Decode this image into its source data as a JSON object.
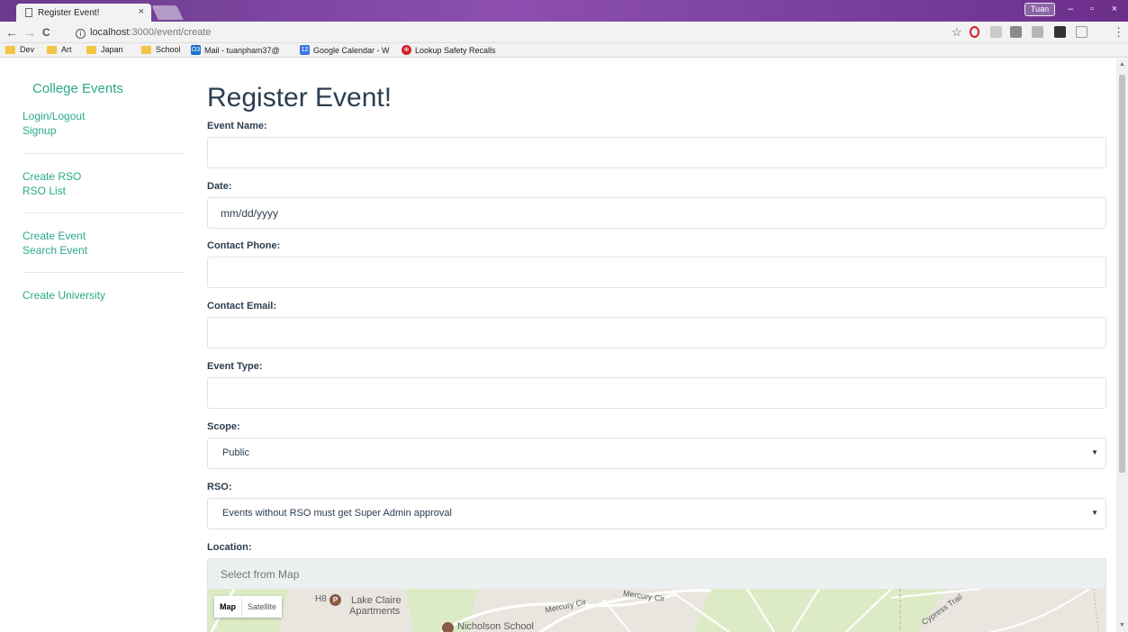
{
  "browser": {
    "tab_title": "Register Event!",
    "tab_close": "×",
    "user_badge": "Tuan",
    "url_host": "localhost",
    "url_path": ":3000/event/create",
    "window_controls": {
      "minimize": "–",
      "maximize": "▫",
      "close": "×"
    },
    "nav": {
      "back": "←",
      "forward": "→",
      "reload": "C"
    },
    "star": "☆",
    "menu": "⋮"
  },
  "bookmarks": [
    {
      "label": "Dev",
      "icon": "folder-icon"
    },
    {
      "label": "Art",
      "icon": "folder-icon"
    },
    {
      "label": "Japan",
      "icon": "folder-icon"
    },
    {
      "label": "School",
      "icon": "folder-icon"
    },
    {
      "label": "Mail - tuanpham37@",
      "icon": "outlook-icon",
      "badge": "O3"
    },
    {
      "label": "Google Calendar - W",
      "icon": "calendar-icon",
      "badge": "12"
    },
    {
      "label": "Lookup Safety Recalls",
      "icon": "toyota-icon",
      "badge": "⊕"
    }
  ],
  "sidebar": {
    "brand": "College Events",
    "groups": [
      [
        "Login/Logout",
        "Signup"
      ],
      [
        "Create RSO",
        "RSO List"
      ],
      [
        "Create Event",
        "Search Event"
      ],
      [
        "Create University"
      ]
    ]
  },
  "form": {
    "title": "Register Event!",
    "event_name_label": "Event Name:",
    "event_name_value": "",
    "date_label": "Date:",
    "date_placeholder": "mm/dd/yyyy",
    "contact_phone_label": "Contact Phone:",
    "contact_phone_value": "",
    "contact_email_label": "Contact Email:",
    "contact_email_value": "",
    "event_type_label": "Event Type:",
    "event_type_value": "",
    "scope_label": "Scope:",
    "scope_value": "Public",
    "rso_label": "RSO:",
    "rso_value": "Events without RSO must get Super Admin approval",
    "location_label": "Location:",
    "location_placeholder": "Select from Map"
  },
  "map": {
    "toggle_map": "Map",
    "toggle_satellite": "Satellite",
    "poi_h8": "H8",
    "poi_p": "P",
    "place_1a": "Lake Claire",
    "place_1b": "Apartments",
    "place_2": "Nicholson School",
    "road_1": "Mercury Cir",
    "road_2": "Mercury Cir",
    "road_3": "Cypress Trail"
  },
  "colors": {
    "accent": "#29a98b",
    "text": "#2c3e50",
    "titlebar": "#7a3f9e"
  }
}
